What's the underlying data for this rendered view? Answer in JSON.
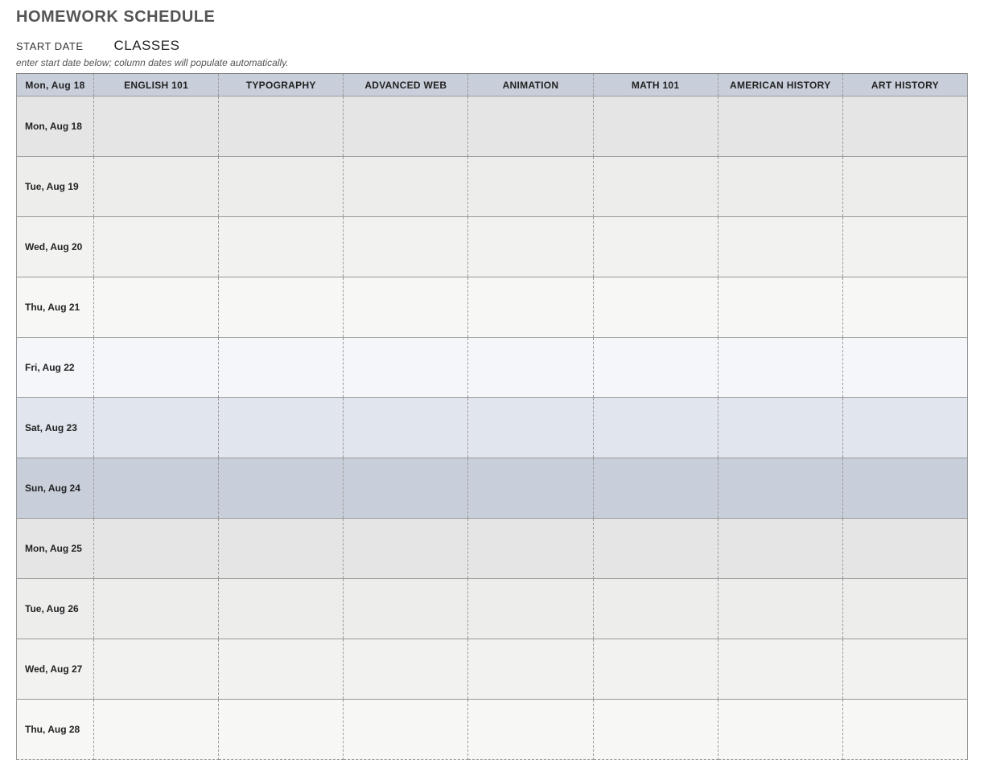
{
  "title": "HOMEWORK SCHEDULE",
  "labels": {
    "start_date": "START DATE",
    "classes": "CLASSES",
    "hint": "enter start date below; column dates will populate automatically."
  },
  "header": {
    "date_col": "Mon, Aug 18",
    "classes": [
      "ENGLISH 101",
      "TYPOGRAPHY",
      "ADVANCED WEB",
      "ANIMATION",
      "MATH 101",
      "AMERICAN HISTORY",
      "ART HISTORY"
    ]
  },
  "rows": [
    {
      "date": "Mon, Aug 18",
      "shade": 0,
      "cells": [
        "",
        "",
        "",
        "",
        "",
        "",
        ""
      ]
    },
    {
      "date": "Tue, Aug 19",
      "shade": 1,
      "cells": [
        "",
        "",
        "",
        "",
        "",
        "",
        ""
      ]
    },
    {
      "date": "Wed, Aug 20",
      "shade": 2,
      "cells": [
        "",
        "",
        "",
        "",
        "",
        "",
        ""
      ]
    },
    {
      "date": "Thu, Aug 21",
      "shade": 3,
      "cells": [
        "",
        "",
        "",
        "",
        "",
        "",
        ""
      ]
    },
    {
      "date": "Fri, Aug 22",
      "shade": 4,
      "cells": [
        "",
        "",
        "",
        "",
        "",
        "",
        ""
      ]
    },
    {
      "date": "Sat, Aug 23",
      "shade": 5,
      "cells": [
        "",
        "",
        "",
        "",
        "",
        "",
        ""
      ]
    },
    {
      "date": "Sun, Aug 24",
      "shade": 6,
      "cells": [
        "",
        "",
        "",
        "",
        "",
        "",
        ""
      ]
    },
    {
      "date": "Mon, Aug 25",
      "shade": 0,
      "cells": [
        "",
        "",
        "",
        "",
        "",
        "",
        ""
      ]
    },
    {
      "date": "Tue, Aug 26",
      "shade": 1,
      "cells": [
        "",
        "",
        "",
        "",
        "",
        "",
        ""
      ]
    },
    {
      "date": "Wed, Aug 27",
      "shade": 2,
      "cells": [
        "",
        "",
        "",
        "",
        "",
        "",
        ""
      ]
    },
    {
      "date": "Thu, Aug 28",
      "shade": 3,
      "cells": [
        "",
        "",
        "",
        "",
        "",
        "",
        ""
      ]
    }
  ]
}
